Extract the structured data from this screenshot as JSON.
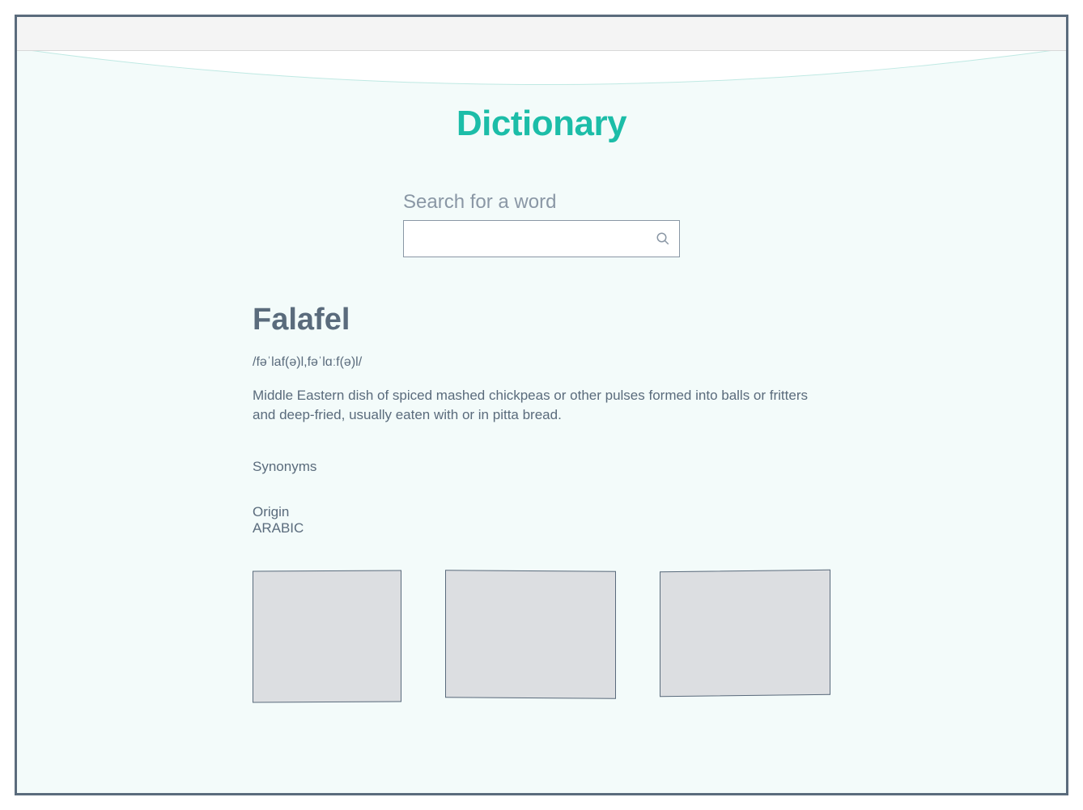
{
  "app": {
    "title": "Dictionary"
  },
  "search": {
    "label": "Search for a word",
    "value": "",
    "placeholder": ""
  },
  "entry": {
    "word": "Falafel",
    "pronunciation": "/fəˈlaf(ə)l,fəˈlɑːf(ə)l/",
    "definition": "Middle Eastern dish of spiced mashed chickpeas or other pulses formed into balls or fritters and deep-fried, usually eaten with or in pitta bread.",
    "synonyms_label": "Synonyms",
    "origin_label": "Origin",
    "origin_value": "ARABIC"
  }
}
